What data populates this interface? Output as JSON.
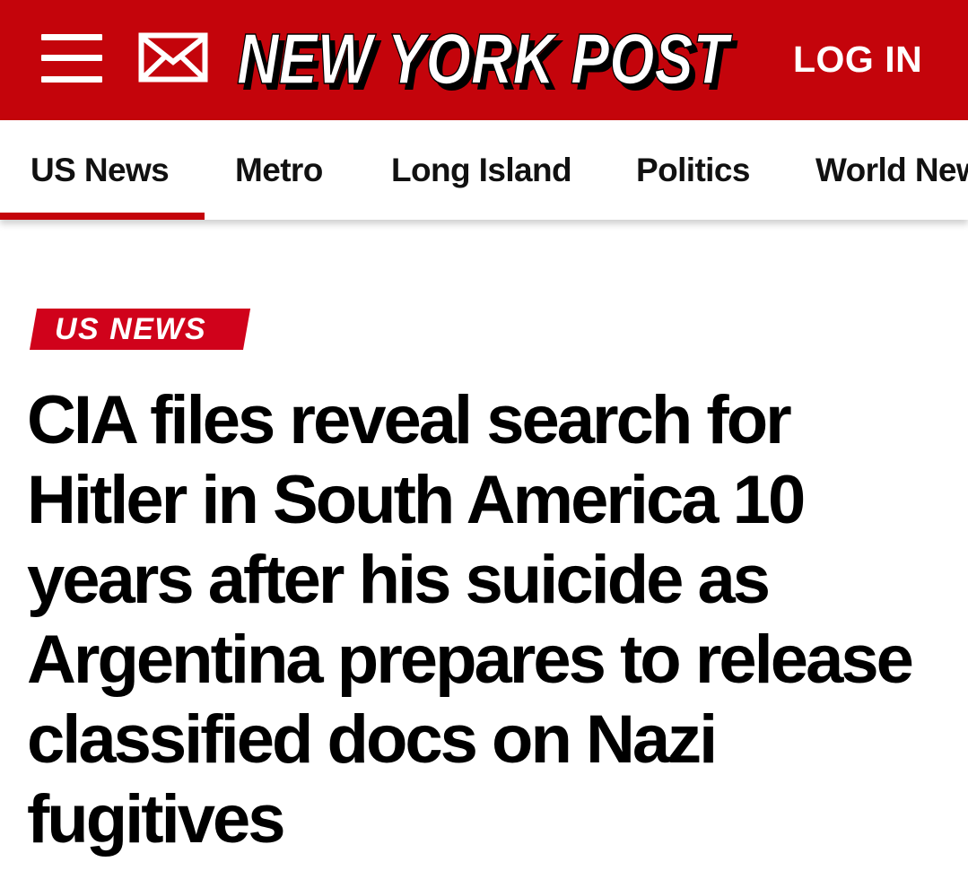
{
  "header": {
    "brand": "NEW YORK POST",
    "login_label": "LOG IN",
    "brand_color": "#c4040b",
    "icons": {
      "menu": "hamburger-menu-icon",
      "mail": "mail-envelope-icon"
    }
  },
  "nav": {
    "items": [
      {
        "label": "US News",
        "active": true
      },
      {
        "label": "Metro",
        "active": false
      },
      {
        "label": "Long Island",
        "active": false
      },
      {
        "label": "Politics",
        "active": false
      },
      {
        "label": "World News",
        "active": false
      }
    ]
  },
  "article": {
    "section_tag": "US NEWS",
    "headline": "CIA files reveal search for Hitler in South America 10 years after his suicide as Argentina prepares to release classified docs on Nazi fugitives"
  }
}
